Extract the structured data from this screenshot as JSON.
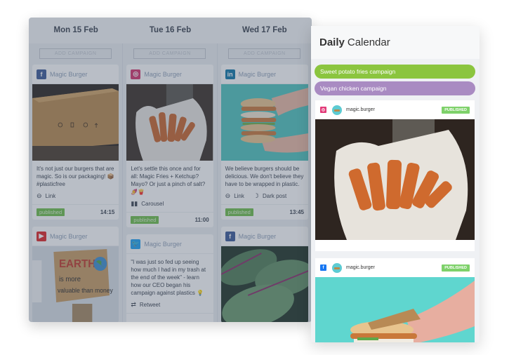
{
  "week": {
    "days": [
      "Mon 15 Feb",
      "Tue 16 Feb",
      "Wed 17 Feb"
    ],
    "add_campaign_label": "ADD CAMPAIGN",
    "columns": [
      {
        "cards": [
          {
            "network": "facebook",
            "brand": "Magic Burger",
            "image": "cardboard-packaging-photo",
            "text": "It's not just our burgers that are magic. So is our packaging! 📦#plasticfree",
            "meta": [
              {
                "icon": "link-icon",
                "label": "Link"
              }
            ],
            "status": "published",
            "time": "14:15"
          },
          {
            "network": "youtube",
            "brand": "Magic Burger",
            "image": "earth-protest-sign-photo"
          }
        ]
      },
      {
        "cards": [
          {
            "network": "instagram",
            "brand": "Magic Burger",
            "image": "sweet-potato-fries-photo",
            "text": "Let's settle this once and for all: Magic Fries + Ketchup? Mayo? Or just a pinch of salt? 🍠🍟",
            "meta": [
              {
                "icon": "carousel-icon",
                "label": "Carousel"
              }
            ],
            "status": "published",
            "time": "11:00"
          },
          {
            "network": "twitter",
            "brand": "Magic Burger",
            "text": "\"I was just so fed up seeing how much I had in my trash at the end of the week\" - learn how our CEO began his campaign against plastics 💡",
            "meta": [
              {
                "icon": "retweet-icon",
                "label": "Retweet"
              }
            ]
          }
        ]
      },
      {
        "cards": [
          {
            "network": "linkedin",
            "brand": "Magic Burger",
            "image": "stacked-burgers-photo",
            "text": "We believe burgers should be delicious. We don't believe they have to be wrapped in plastic.",
            "meta": [
              {
                "icon": "link-icon",
                "label": "Link"
              },
              {
                "icon": "moon-icon",
                "label": "Dark post"
              }
            ],
            "status": "published",
            "time": "13:45"
          },
          {
            "network": "facebook",
            "brand": "Magic Burger",
            "image": "leafy-greens-photo"
          }
        ]
      }
    ]
  },
  "daily": {
    "title_bold": "Daily",
    "title_rest": "Calendar",
    "campaigns": [
      {
        "label": "Sweet potato fries campaign",
        "color": "#8bc53f"
      },
      {
        "label": "Vegan chicken campaign",
        "color": "#a98bc2"
      }
    ],
    "posts": [
      {
        "network": "instagram",
        "handle": "magic.burger",
        "status": "PUBLISHED",
        "image": "sweet-potato-fries-photo"
      },
      {
        "network": "facebook",
        "handle": "magic.burger",
        "status": "PUBLISHED",
        "image": "burger-in-hand-photo"
      }
    ]
  },
  "colors": {
    "published": "#6fbf4b",
    "facebook": "#3b5998",
    "instagram": "#d6336c",
    "linkedin": "#0e76a8",
    "youtube": "#e02424",
    "twitter": "#1da1f2"
  }
}
